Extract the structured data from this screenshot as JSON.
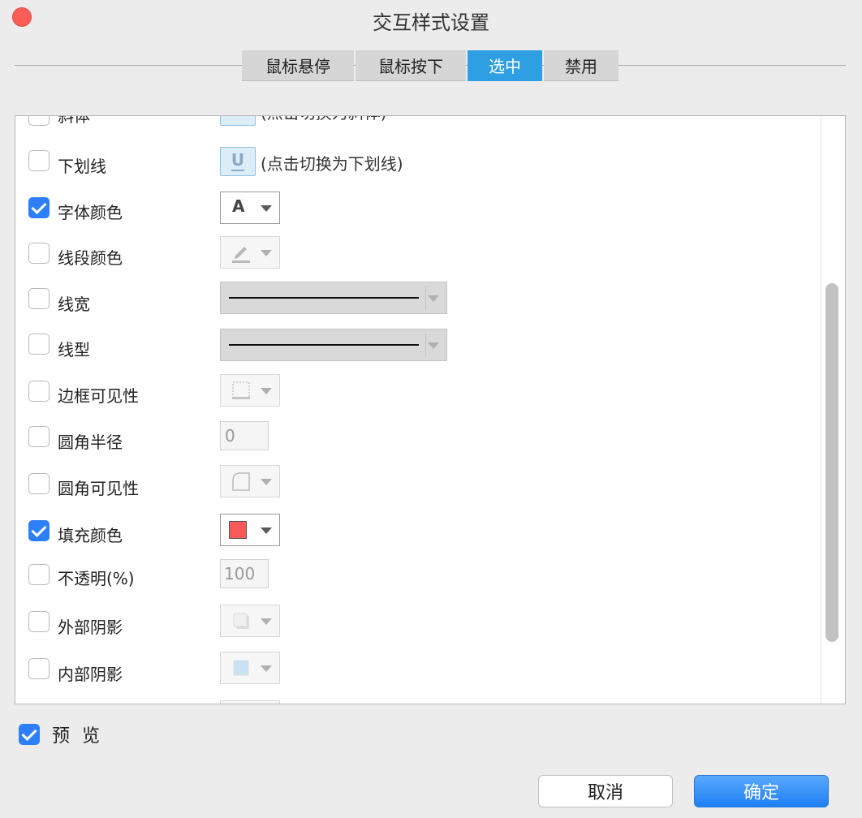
{
  "window": {
    "title": "交互样式设置"
  },
  "tabs": [
    {
      "label": "鼠标悬停",
      "active": false
    },
    {
      "label": "鼠标按下",
      "active": false
    },
    {
      "label": "选中",
      "active": true
    },
    {
      "label": "禁用",
      "active": false
    }
  ],
  "props": {
    "italic": {
      "label": "斜体",
      "checked": false,
      "hint": "(点击切换为斜体)"
    },
    "underline": {
      "label": "下划线",
      "checked": false,
      "hint": "(点击切换为下划线)"
    },
    "font_color": {
      "label": "字体颜色",
      "checked": true,
      "glyph": "A"
    },
    "line_color": {
      "label": "线段颜色",
      "checked": false
    },
    "line_width": {
      "label": "线宽",
      "checked": false
    },
    "line_type": {
      "label": "线型",
      "checked": false
    },
    "border_visibility": {
      "label": "边框可见性",
      "checked": false
    },
    "corner_radius": {
      "label": "圆角半径",
      "checked": false,
      "value": "0"
    },
    "corner_visibility": {
      "label": "圆角可见性",
      "checked": false
    },
    "fill_color": {
      "label": "填充颜色",
      "checked": true,
      "color": "#f85a5a"
    },
    "opacity": {
      "label": "不透明(%)",
      "checked": false,
      "value": "100"
    },
    "outer_shadow": {
      "label": "外部阴影",
      "checked": false
    },
    "inner_shadow": {
      "label": "内部阴影",
      "checked": false
    }
  },
  "footer": {
    "preview_label": "预 览",
    "preview_checked": true,
    "cancel_label": "取消",
    "ok_label": "确定"
  },
  "colors": {
    "accent": "#2e9fe2",
    "checkbox": "#2d7ff9",
    "close": "#fc5d57"
  }
}
